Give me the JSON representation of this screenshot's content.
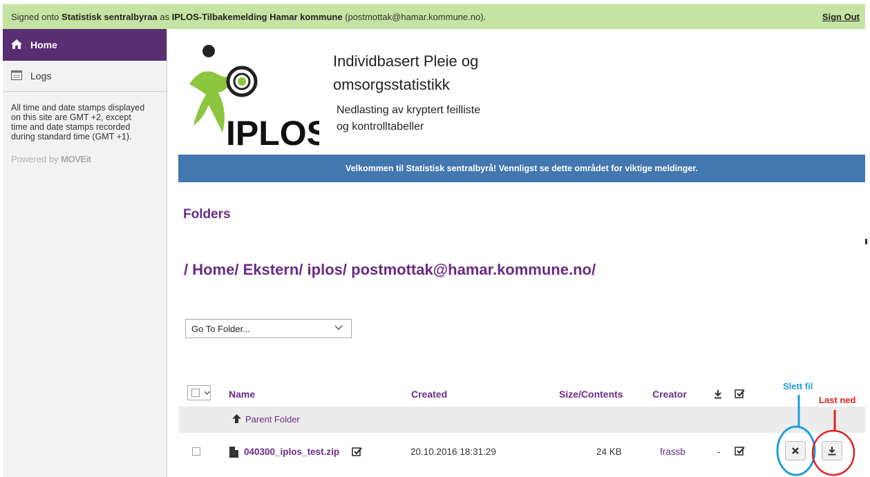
{
  "topbar": {
    "prefix": "Signed onto",
    "org": "Statistisk sentralbyraa",
    "as": "as",
    "user": "IPLOS-Tilbakemelding Hamar kommune",
    "email": "(postmottak@hamar.kommune.no).",
    "sign_out": "Sign Out"
  },
  "sidebar": {
    "home": "Home",
    "logs": "Logs",
    "note": "All time and date stamps displayed on this site are GMT +2, except time and date stamps recorded during standard time (GMT +1).",
    "powered_prefix": "Powered by",
    "powered_brand": "MOVEit"
  },
  "header": {
    "logo_text": "IPLOS",
    "title_line1": "Individbasert Pleie og",
    "title_line2": "omsorgsstatistikk",
    "sub_line1": "Nedlasting av kryptert feilliste",
    "sub_line2": "og kontrolltabeller"
  },
  "welcome": "Velkommen til Statistisk sentralbyrå! Vennligst se dette området for viktige meldinger.",
  "folders_heading": "Folders",
  "breadcrumb": [
    "/ Home/",
    "Ekstern/",
    "iplos/",
    "postmottak@hamar.kommune.no/"
  ],
  "goto_folder": "Go To Folder...",
  "table": {
    "headers": {
      "name": "Name",
      "created": "Created",
      "size": "Size/Contents",
      "creator": "Creator"
    },
    "parent": "Parent Folder",
    "file": {
      "name": "040300_iplos_test.zip",
      "created": "20.10.2016 18:31:29",
      "size": "24 KB",
      "creator": "frassb",
      "downloads": "-"
    }
  },
  "annotations": {
    "delete_label": "Slett fil",
    "download_label": "Last ned",
    "delete_color": "#1e9be0",
    "download_color": "#e02020"
  },
  "colors": {
    "topbar": "#c5e3a2",
    "home_active": "#5a2e73",
    "accent_purple": "#6b2b84",
    "welcome_bar": "#4277b0",
    "logo_green": "#8cc63f"
  }
}
